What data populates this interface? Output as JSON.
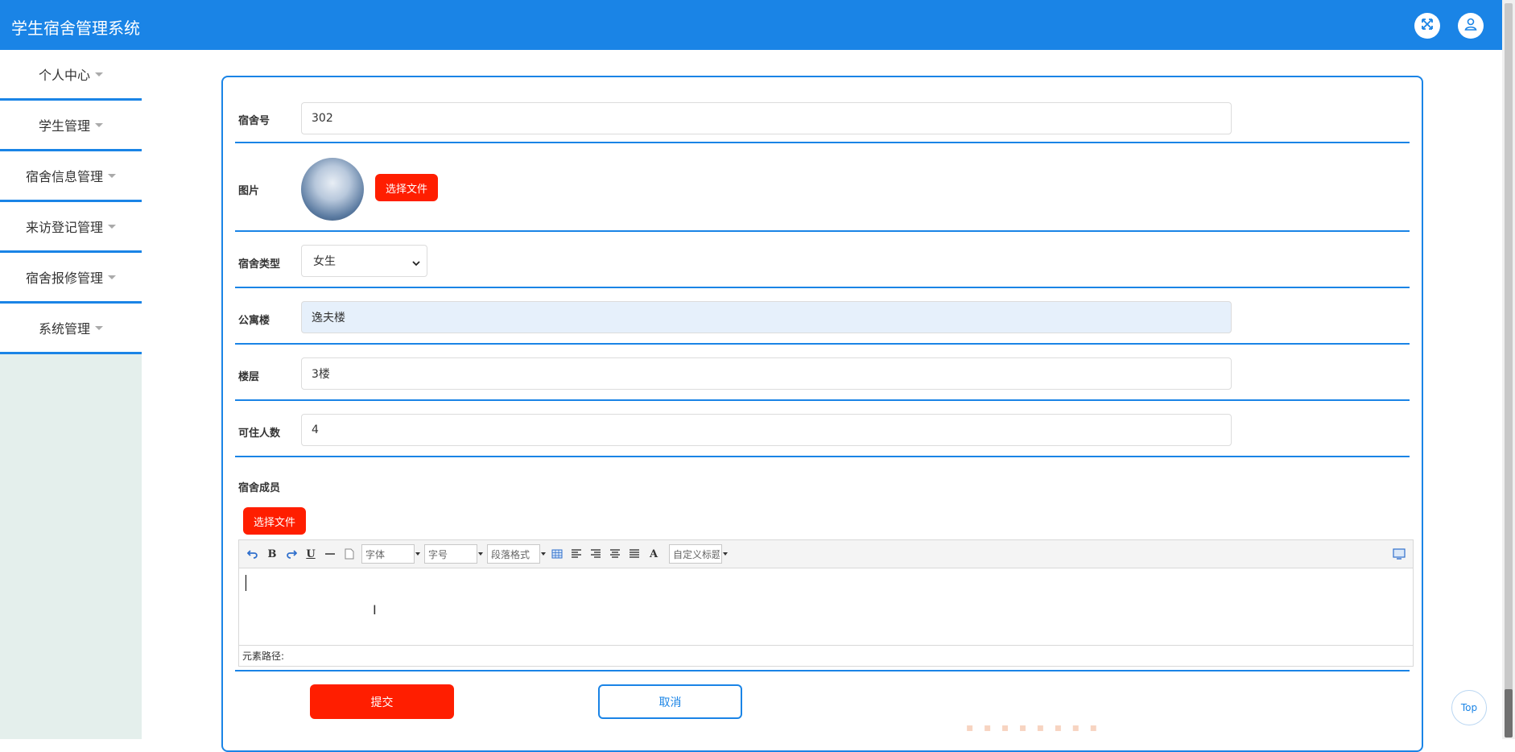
{
  "app": {
    "title": "学生宿舍管理系统"
  },
  "header": {
    "fullscreen_icon": "fullscreen-icon",
    "user_icon": "user-icon"
  },
  "sidebar": {
    "items": [
      {
        "label": "个人中心"
      },
      {
        "label": "学生管理"
      },
      {
        "label": "宿舍信息管理"
      },
      {
        "label": "来访登记管理"
      },
      {
        "label": "宿舍报修管理"
      },
      {
        "label": "系统管理"
      }
    ]
  },
  "form": {
    "dorm_no": {
      "label": "宿舍号",
      "value": "302"
    },
    "image": {
      "label": "图片",
      "button": "选择文件"
    },
    "dorm_type": {
      "label": "宿舍类型",
      "value": "女生"
    },
    "building": {
      "label": "公寓楼",
      "value": "逸夫楼"
    },
    "floor": {
      "label": "楼层",
      "value": "3楼"
    },
    "capacity": {
      "label": "可住人数",
      "value": "4"
    },
    "members": {
      "label": "宿舍成员",
      "button": "选择文件"
    }
  },
  "editor": {
    "font_combo": "字体",
    "size_combo": "字号",
    "paragraph_combo": "段落格式",
    "custom_combo": "自定义标题",
    "path_label": "元素路径:"
  },
  "actions": {
    "submit": "提交",
    "cancel": "取消"
  },
  "back_to_top": "Top",
  "colors": {
    "primary": "#1a84e6",
    "danger": "#ff1e00",
    "sidebar_bg": "#e4efec"
  }
}
